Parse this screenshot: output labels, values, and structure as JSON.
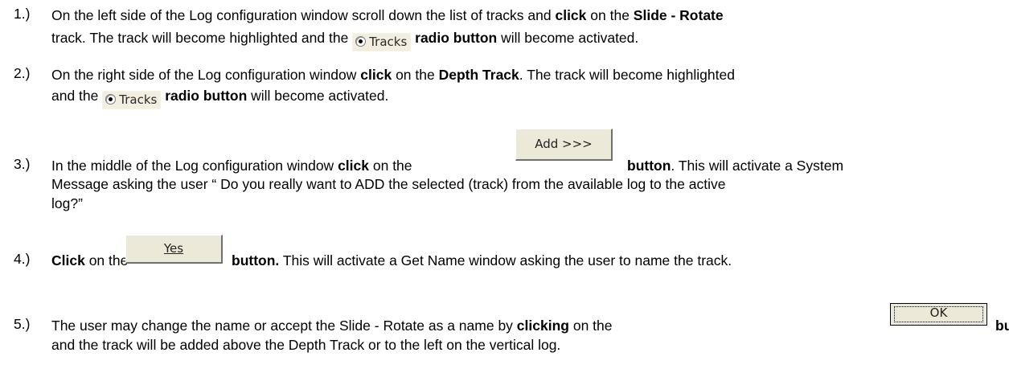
{
  "steps": [
    {
      "num": "1.)",
      "p1": "On the left side of the Log configuration window scroll down the list of tracks and ",
      "b1": "click",
      "p2": " on the ",
      "b2": "Slide - Rotate",
      "p3": "track. The track will become highlighted and the ",
      "b3": "radio button",
      "p4": " will become activated."
    },
    {
      "num": "2.)",
      "p1": "On the right side of the Log configuration window ",
      "b1": "click",
      "p2": " on the ",
      "b2": "Depth Track",
      "p3": ". The track will become highlighted",
      "p4": "and the ",
      "b3": "radio button",
      "p5": " will become activated."
    },
    {
      "num": "3.)",
      "p1": "In the middle of the Log configuration window ",
      "b1": "click",
      "p2": " on the ",
      "b2": "button",
      "p3": ". This will activate a System",
      "p4": "Message asking the user “ Do you really want to ADD the selected (track) from the available log to the active",
      "p5": "log?”"
    },
    {
      "num": "4.)",
      "b1": "Click",
      "p1": " on the ",
      "b2": "button.",
      "p2": " This will activate a Get Name window asking the user to name the track."
    },
    {
      "num": "5.)",
      "p1": "The user may change the name or accept the Slide - Rotate as a name by ",
      "b1": "clicking",
      "p2": " on the ",
      "b2": "button",
      "p3": "and the track will be added above the Depth Track or to the left on the vertical log."
    }
  ],
  "widgets": {
    "tracks_radio_label": "Tracks",
    "add_button_label": "Add >>>",
    "yes_button_label": "Yes",
    "ok_button_label": "OK"
  }
}
